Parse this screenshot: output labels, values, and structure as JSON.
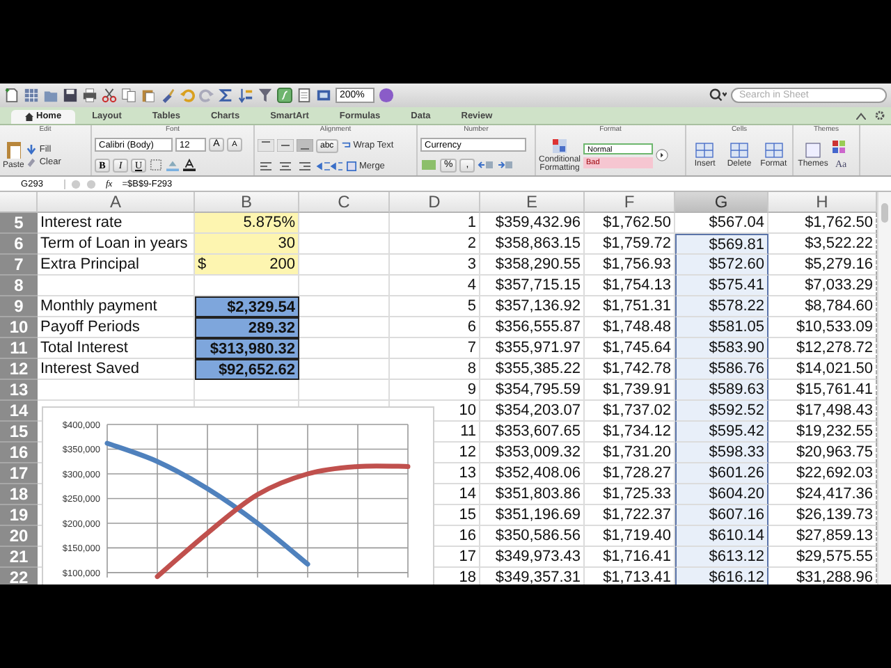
{
  "toolbar": {
    "zoom": "200%",
    "search": {
      "placeholder": "Search in Sheet"
    }
  },
  "ribbon": {
    "tabs": [
      {
        "label": "Home",
        "selected": true
      },
      {
        "label": "Layout",
        "selected": false
      },
      {
        "label": "Tables",
        "selected": false
      },
      {
        "label": "Charts",
        "selected": false
      },
      {
        "label": "SmartArt",
        "selected": false
      },
      {
        "label": "Formulas",
        "selected": false
      },
      {
        "label": "Data",
        "selected": false
      },
      {
        "label": "Review",
        "selected": false
      }
    ],
    "edit": {
      "title": "Edit",
      "paste": "Paste",
      "fill": "Fill",
      "clear": "Clear"
    },
    "font": {
      "title": "Font",
      "family": "Calibri (Body)",
      "size": "12",
      "grow": "A",
      "shrink": "A",
      "bold": "B",
      "italic": "I",
      "underline": "U"
    },
    "alignment": {
      "title": "Alignment",
      "orientation": "abc",
      "wrap": "Wrap Text",
      "merge": "Merge"
    },
    "number": {
      "title": "Number",
      "format": "Currency",
      "percent": "%",
      "comma": ","
    },
    "format": {
      "title": "Format",
      "conditional": "Conditional Formatting",
      "styles": [
        {
          "label": "Normal",
          "kind": "normal"
        },
        {
          "label": "Bad",
          "kind": "bad"
        }
      ]
    },
    "cells": {
      "title": "Cells",
      "buttons": [
        "Insert",
        "Delete",
        "Format"
      ]
    },
    "themes": {
      "title": "Themes",
      "themes": "Themes",
      "fonts": "Aa"
    }
  },
  "formula_bar": {
    "name_box": "G293",
    "fx": "fx",
    "formula": "=$B$9-F293"
  },
  "sheet": {
    "columns": [
      {
        "label": "A",
        "selected": false
      },
      {
        "label": "B",
        "selected": false
      },
      {
        "label": "C",
        "selected": false
      },
      {
        "label": "D",
        "selected": false
      },
      {
        "label": "E",
        "selected": false
      },
      {
        "label": "F",
        "selected": false
      },
      {
        "label": "G",
        "selected": true
      },
      {
        "label": "H",
        "selected": false
      }
    ],
    "rows": [
      {
        "header": "5",
        "kind": "input",
        "a": "Interest rate",
        "b": "5.875%",
        "d": "1",
        "e": "$359,432.96",
        "f": "$1,762.50",
        "g": {
          "text": "$567.04",
          "selected": false
        },
        "h": "$1,762.50"
      },
      {
        "header": "6",
        "kind": "input",
        "a": "Term of Loan in years",
        "b": "30",
        "d": "2",
        "e": "$358,863.15",
        "f": "$1,759.72",
        "g": {
          "text": "$569.81",
          "selected": true
        },
        "h": "$3,522.22"
      },
      {
        "header": "7",
        "kind": "input",
        "a": "Extra Principal",
        "b_prefix": "$",
        "b": "200",
        "d": "3",
        "e": "$358,290.55",
        "f": "$1,756.93",
        "g": {
          "text": "$572.60",
          "selected": true
        },
        "h": "$5,279.16"
      },
      {
        "header": "8",
        "kind": "plain",
        "d": "4",
        "e": "$357,715.15",
        "f": "$1,754.13",
        "g": {
          "text": "$575.41",
          "selected": true
        },
        "h": "$7,033.29"
      },
      {
        "header": "9",
        "kind": "result",
        "a": "Monthly payment",
        "b": "$2,329.54",
        "d": "5",
        "e": "$357,136.92",
        "f": "$1,751.31",
        "g": {
          "text": "$578.22",
          "selected": true
        },
        "h": "$8,784.60"
      },
      {
        "header": "10",
        "kind": "result",
        "a": "Payoff Periods",
        "b": "289.32",
        "d": "6",
        "e": "$356,555.87",
        "f": "$1,748.48",
        "g": {
          "text": "$581.05",
          "selected": true
        },
        "h": "$10,533.09"
      },
      {
        "header": "11",
        "kind": "result",
        "a": "Total Interest",
        "b": "$313,980.32",
        "d": "7",
        "e": "$355,971.97",
        "f": "$1,745.64",
        "g": {
          "text": "$583.90",
          "selected": true
        },
        "h": "$12,278.72"
      },
      {
        "header": "12",
        "kind": "result",
        "a": "Interest Saved",
        "b": "$92,652.62",
        "d": "8",
        "e": "$355,385.22",
        "f": "$1,742.78",
        "g": {
          "text": "$586.76",
          "selected": true
        },
        "h": "$14,021.50"
      },
      {
        "header": "13",
        "kind": "plain",
        "d": "9",
        "e": "$354,795.59",
        "f": "$1,739.91",
        "g": {
          "text": "$589.63",
          "selected": true
        },
        "h": "$15,761.41"
      },
      {
        "header": "14",
        "kind": "plain",
        "d": "10",
        "e": "$354,203.07",
        "f": "$1,737.02",
        "g": {
          "text": "$592.52",
          "selected": true
        },
        "h": "$17,498.43"
      },
      {
        "header": "15",
        "kind": "plain",
        "d": "11",
        "e": "$353,607.65",
        "f": "$1,734.12",
        "g": {
          "text": "$595.42",
          "selected": true
        },
        "h": "$19,232.55"
      },
      {
        "header": "16",
        "kind": "plain",
        "d": "12",
        "e": "$353,009.32",
        "f": "$1,731.20",
        "g": {
          "text": "$598.33",
          "selected": true
        },
        "h": "$20,963.75"
      },
      {
        "header": "17",
        "kind": "plain",
        "d": "13",
        "e": "$352,408.06",
        "f": "$1,728.27",
        "g": {
          "text": "$601.26",
          "selected": true
        },
        "h": "$22,692.03"
      },
      {
        "header": "18",
        "kind": "plain",
        "d": "14",
        "e": "$351,803.86",
        "f": "$1,725.33",
        "g": {
          "text": "$604.20",
          "selected": true
        },
        "h": "$24,417.36"
      },
      {
        "header": "19",
        "kind": "plain",
        "d": "15",
        "e": "$351,196.69",
        "f": "$1,722.37",
        "g": {
          "text": "$607.16",
          "selected": true
        },
        "h": "$26,139.73"
      },
      {
        "header": "20",
        "kind": "plain",
        "d": "16",
        "e": "$350,586.56",
        "f": "$1,719.40",
        "g": {
          "text": "$610.14",
          "selected": true
        },
        "h": "$27,859.13"
      },
      {
        "header": "21",
        "kind": "plain",
        "d": "17",
        "e": "$349,973.43",
        "f": "$1,716.41",
        "g": {
          "text": "$613.12",
          "selected": true
        },
        "h": "$29,575.55"
      },
      {
        "header": "22",
        "kind": "plain",
        "d": "18",
        "e": "$349,357.31",
        "f": "$1,713.41",
        "g": {
          "text": "$616.12",
          "selected": true
        },
        "h": "$31,288.96"
      }
    ]
  },
  "chart": {
    "chart_data": {
      "type": "line",
      "ylim": [
        90000,
        400000
      ],
      "grid": true,
      "yticks": [
        {
          "value": 100000,
          "label": "$100,000"
        },
        {
          "value": 150000,
          "label": "$150,000"
        },
        {
          "value": 200000,
          "label": "$200,000"
        },
        {
          "value": 250000,
          "label": "$250,000"
        },
        {
          "value": 300000,
          "label": "$300,000"
        },
        {
          "value": 350000,
          "label": "$350,000"
        },
        {
          "value": 400000,
          "label": "$400,000"
        }
      ],
      "series": [
        {
          "color": "#4f81bd",
          "values": [
            362000,
            325000,
            270000,
            200000,
            117000,
            null,
            null
          ]
        },
        {
          "color": "#c0504d",
          "values": [
            null,
            92000,
            180000,
            258000,
            300000,
            315000,
            315000
          ]
        }
      ]
    }
  }
}
